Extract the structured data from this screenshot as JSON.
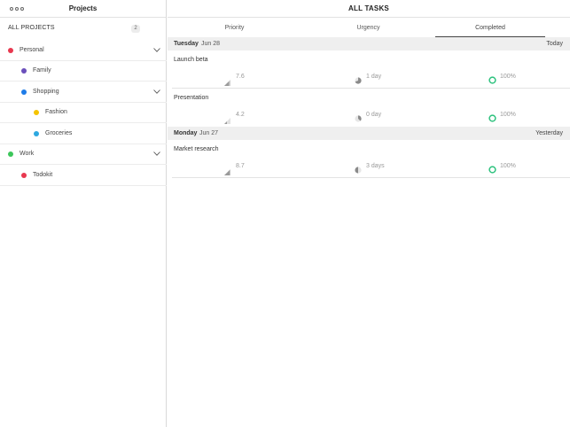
{
  "sidebar": {
    "title": "Projects",
    "all_projects_label": "ALL PROJECTS",
    "all_projects_count": "2",
    "projects": [
      {
        "name": "Personal",
        "color": "#e8384f",
        "level": 0,
        "expandable": true
      },
      {
        "name": "Family",
        "color": "#6b4fbb",
        "level": 1,
        "expandable": false
      },
      {
        "name": "Shopping",
        "color": "#1e7ce8",
        "level": 1,
        "expandable": true
      },
      {
        "name": "Fashion",
        "color": "#f5c400",
        "level": 2,
        "expandable": false
      },
      {
        "name": "Groceries",
        "color": "#2ea8e0",
        "level": 2,
        "expandable": false
      },
      {
        "name": "Work",
        "color": "#3cc65a",
        "level": 0,
        "expandable": true
      },
      {
        "name": "Todokit",
        "color": "#e8384f",
        "level": 1,
        "expandable": false
      }
    ]
  },
  "main": {
    "title": "ALL TASKS",
    "tabs": [
      {
        "label": "Priority",
        "active": false
      },
      {
        "label": "Urgency",
        "active": false
      },
      {
        "label": "Completed",
        "active": true
      }
    ],
    "sections": [
      {
        "day": "Tuesday",
        "date": "Jun 28",
        "relative": "Today",
        "tasks": [
          {
            "name": "Launch beta",
            "priority": "7.6",
            "urgency": "1 day",
            "completed": "100%"
          },
          {
            "name": "Presentation",
            "priority": "4.2",
            "urgency": "0 day",
            "completed": "100%"
          }
        ]
      },
      {
        "day": "Monday",
        "date": "Jun 27",
        "relative": "Yesterday",
        "tasks": [
          {
            "name": "Market research",
            "priority": "8.7",
            "urgency": "3 days",
            "completed": "100%"
          }
        ]
      }
    ]
  },
  "colors": {
    "completed_ring": "#2ec27e",
    "priority_icon": "#9a9a9a",
    "urgency_icon": "#8a8a8a"
  }
}
